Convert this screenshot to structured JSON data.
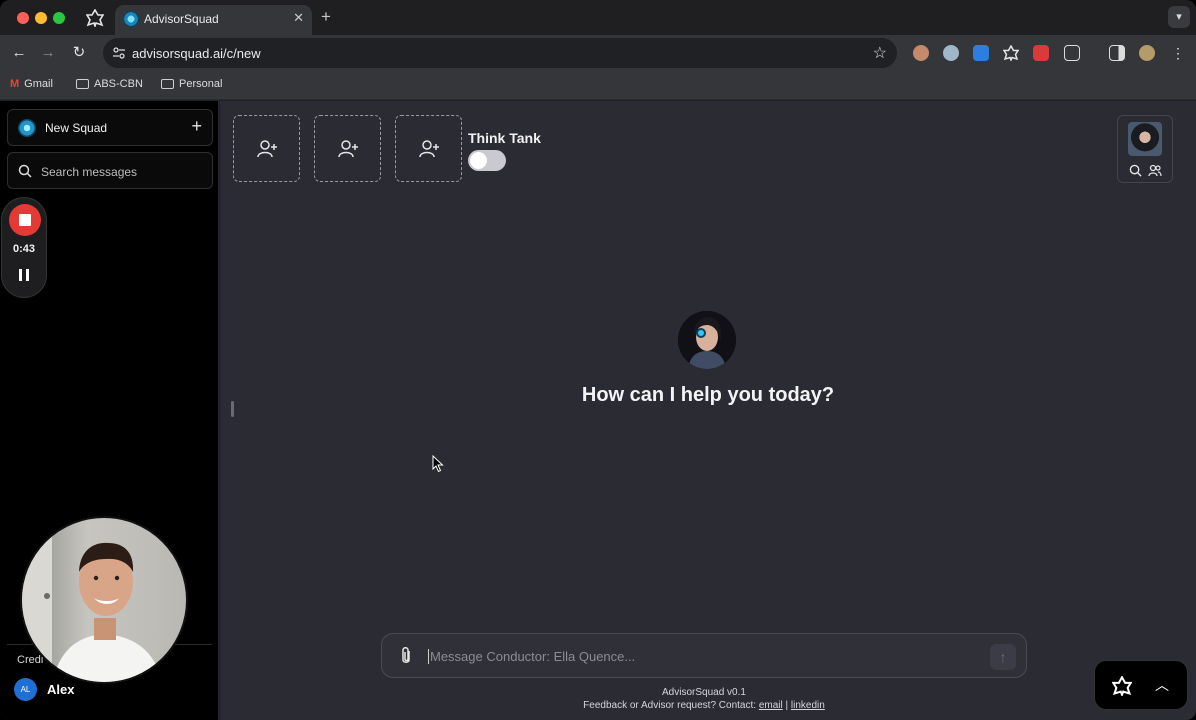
{
  "browser": {
    "tab_title": "AdvisorSquad",
    "tab_close": "✕",
    "new_tab": "+",
    "url": "advisorsquad.ai/c/new",
    "bookmarks": [
      "Gmail",
      "ABS-CBN",
      "Personal"
    ]
  },
  "sidebar": {
    "new_squad_label": "New Squad",
    "new_squad_plus": "+",
    "search_placeholder": "Search messages",
    "recorder_time": "0:43",
    "credits_label": "Credi",
    "user_initials": "AL",
    "user_name": "Alex"
  },
  "header": {
    "think_tank_label": "Think Tank",
    "think_tank_enabled": false
  },
  "main": {
    "greeting": "How can I help you today?",
    "composer_placeholder": "Message Conductor: Ella Quence...",
    "send_icon": "↑",
    "version": "AdvisorSquad v0.1",
    "contact_prefix": "Feedback or Advisor request? Contact: ",
    "contact_email": "email",
    "contact_separator": " | ",
    "contact_linkedin": "linkedin"
  },
  "floating": {
    "expand_icon": "︿"
  },
  "colors": {
    "accent": "#1a86b8",
    "record_red": "#e53935",
    "main_bg": "#2a2b33",
    "sidebar_bg": "#000000"
  }
}
